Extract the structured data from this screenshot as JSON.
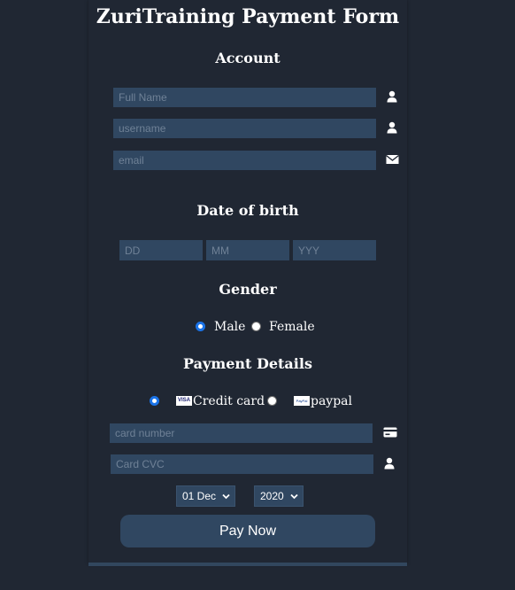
{
  "form": {
    "title": "ZuriTraining Payment Form"
  },
  "account": {
    "heading": "Account",
    "full_name_placeholder": "Full Name",
    "username_placeholder": "username",
    "email_placeholder": "email"
  },
  "dob": {
    "heading": "Date of birth",
    "day_placeholder": "DD",
    "month_placeholder": "MM",
    "year_placeholder": "YYY"
  },
  "gender": {
    "heading": "Gender",
    "male_label": "Male",
    "female_label": "Female",
    "selected": "Male"
  },
  "payment": {
    "heading": "Payment Details",
    "credit_card_label": "Credit card",
    "visa_badge": "VISA",
    "paypal_badge": "PayPal",
    "paypal_label": "paypal",
    "selected": "Credit card",
    "card_number_placeholder": "card number",
    "cvc_placeholder": "Card CVC",
    "expiry_day_value": "01 Dec",
    "expiry_year_value": "2020",
    "submit_label": "Pay Now"
  },
  "colors": {
    "background": "#202733",
    "field": "#304761",
    "placeholder": "#6f8196",
    "radio_accent": "#1a73e8"
  }
}
